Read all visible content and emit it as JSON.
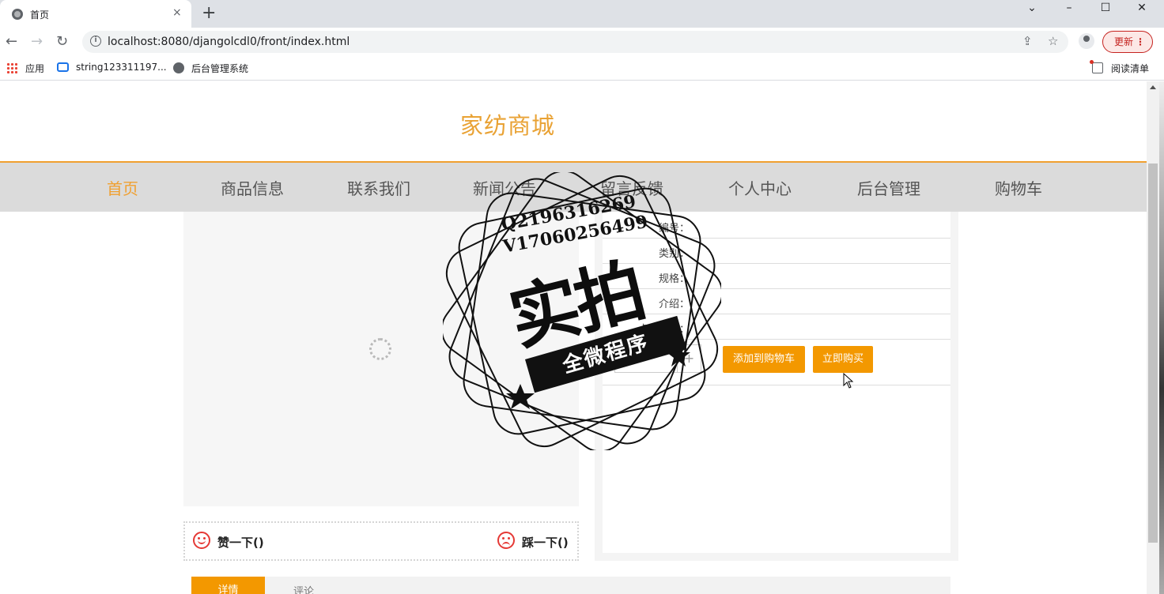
{
  "browser": {
    "tab_title": "首页",
    "tab_close": "×",
    "new_tab": "+",
    "url": "localhost:8080/djangolcdl0/front/index.html",
    "update_label": "更新",
    "update_menu": "⋮",
    "window_controls": {
      "minimize": "–",
      "maximize": "☐",
      "close": "✕",
      "dropdown": "⌄"
    },
    "bookmarks": [
      {
        "label": "应用",
        "icon": "apps-icon"
      },
      {
        "label": "string123311197...",
        "icon": "bilibili-icon"
      },
      {
        "label": "后台管理系统",
        "icon": "globe-icon"
      }
    ],
    "reading_list": "阅读清单"
  },
  "site": {
    "title": "家纺商城",
    "nav": [
      "首页",
      "商品信息",
      "联系我们",
      "新闻公告",
      "留言反馈",
      "个人中心",
      "后台管理",
      "购物车"
    ],
    "active_nav": "首页"
  },
  "product": {
    "fields": [
      "编号：",
      "类别：",
      "规格：",
      "介绍：",
      "点击次数："
    ],
    "qty_plus": "+",
    "add_to_cart": "添加到购物车",
    "buy_now": "立即购买",
    "like": "赞一下()",
    "dislike": "踩一下()"
  },
  "tabs": {
    "detail": "详情",
    "comment": "评论"
  },
  "watermark": {
    "line1": "Q2196316269",
    "line2": "V17060256499",
    "big": "实拍",
    "ribbon": "全微程序"
  },
  "colors": {
    "accent": "#f39800",
    "title": "#e9a234",
    "nav_bg": "#dbdbdb"
  }
}
